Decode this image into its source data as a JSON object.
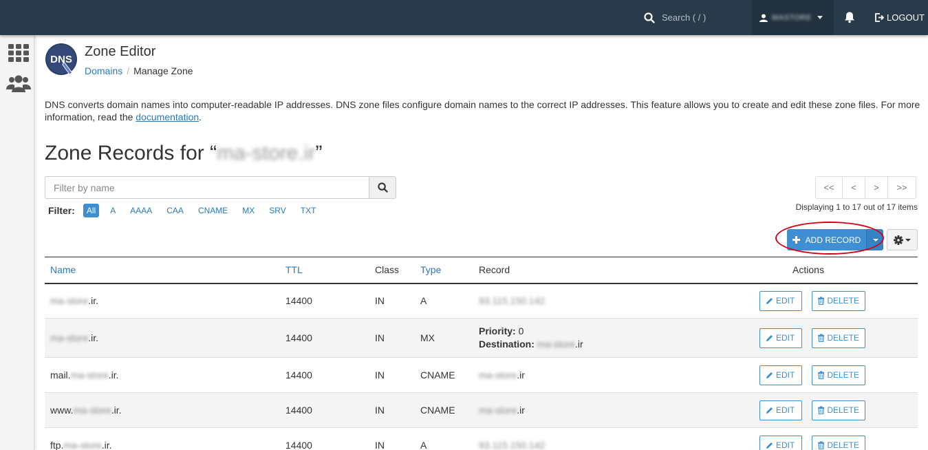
{
  "topbar": {
    "search_placeholder": "Search ( / )",
    "user": "MASTORE",
    "logout": "LOGOUT"
  },
  "header": {
    "logo_text": "DNS",
    "title": "Zone Editor",
    "breadcrumb": {
      "link": "Domains",
      "sep": "/",
      "current": "Manage Zone"
    }
  },
  "description": {
    "text": "DNS converts domain names into computer-readable IP addresses. DNS zone files configure domain names to the correct IP addresses. This feature allows you to create and edit these zone files. For more information, read the ",
    "link": "documentation",
    "end": "."
  },
  "zone": {
    "title_prefix": "Zone Records for “",
    "domain": "ma-store.ir",
    "title_suffix": "”"
  },
  "filter": {
    "placeholder": "Filter by name",
    "label": "Filter:",
    "pills": [
      "All",
      "A",
      "AAAA",
      "CAA",
      "CNAME",
      "MX",
      "SRV",
      "TXT"
    ]
  },
  "pager": {
    "buttons": [
      "<<",
      "<",
      ">",
      ">>"
    ],
    "displaying": "Displaying 1 to 17 out of 17 items"
  },
  "actions": {
    "add_record": "ADD RECORD"
  },
  "table": {
    "headers": {
      "name": "Name",
      "ttl": "TTL",
      "class": "Class",
      "type": "Type",
      "record": "Record",
      "actions": "Actions"
    },
    "edit_label": "EDIT",
    "delete_label": "DELETE",
    "rows": [
      {
        "name_prefix": "",
        "name_blur": "ma-store",
        "name_suffix": ".ir.",
        "ttl": "14400",
        "class": "IN",
        "type": "A",
        "record": "93.115.150.142"
      },
      {
        "name_prefix": "",
        "name_blur": "ma-store",
        "name_suffix": ".ir.",
        "ttl": "14400",
        "class": "IN",
        "type": "MX",
        "priority_label": "Priority:",
        "priority": "0",
        "dest_label": "Destination:",
        "dest_blur": "ma-store",
        "dest_suffix": ".ir"
      },
      {
        "name_prefix": "mail.",
        "name_blur": "ma-store",
        "name_suffix": ".ir.",
        "ttl": "14400",
        "class": "IN",
        "type": "CNAME",
        "record_blur": "ma-store",
        "record_suffix": ".ir"
      },
      {
        "name_prefix": "www.",
        "name_blur": "ma-store",
        "name_suffix": ".ir.",
        "ttl": "14400",
        "class": "IN",
        "type": "CNAME",
        "record_blur": "ma-store",
        "record_suffix": ".ir"
      },
      {
        "name_prefix": "ftp.",
        "name_blur": "ma-store",
        "name_suffix": ".ir.",
        "ttl": "14400",
        "class": "IN",
        "type": "A",
        "record": "93.115.150.142"
      }
    ]
  }
}
